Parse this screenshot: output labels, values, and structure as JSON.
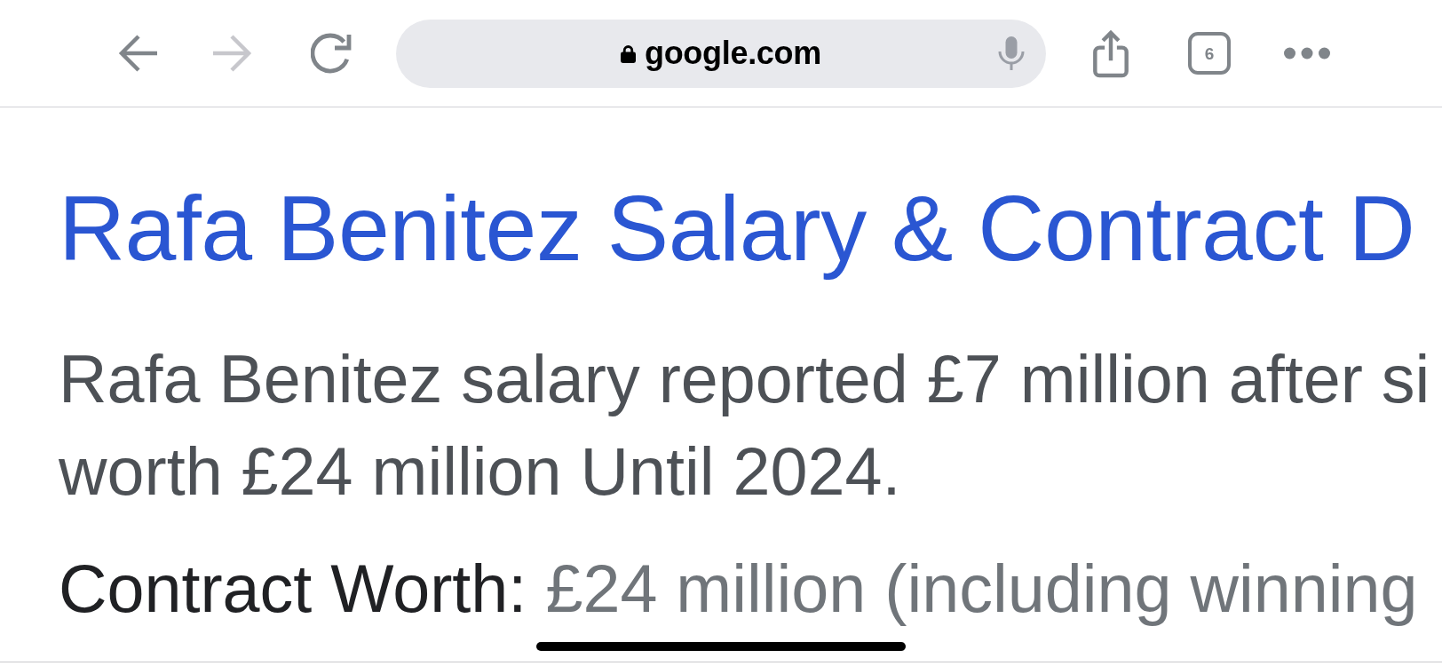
{
  "toolbar": {
    "back": {
      "disabled": false
    },
    "forward": {
      "disabled": true
    },
    "address_bar": {
      "url": "google.com",
      "secure": true
    },
    "tab_count": "6"
  },
  "result": {
    "title": "Rafa Benitez Salary & Contract D",
    "snippet_lines": [
      "Rafa Benitez salary reported £7 million after si",
      "worth £24 million Until 2024."
    ],
    "detail": {
      "label": "Contract Worth:",
      "value": "£24 million (including winning"
    }
  }
}
